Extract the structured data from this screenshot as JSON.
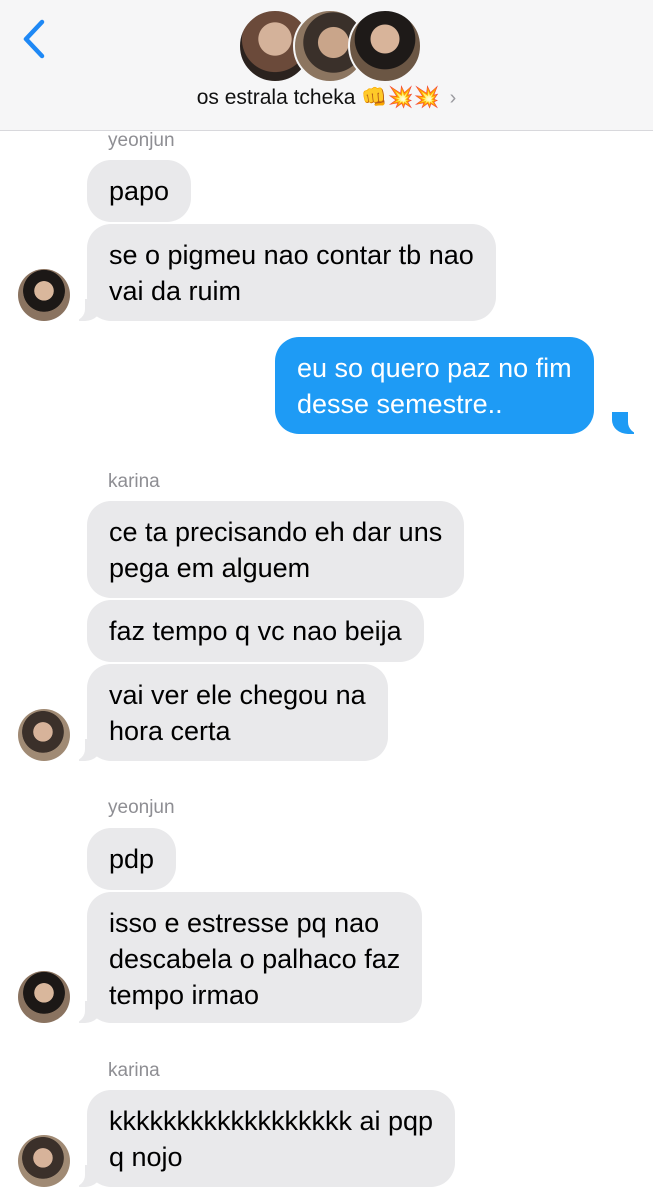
{
  "header": {
    "group_name": "os estrala tcheka 👊💥💥",
    "chevron": "›",
    "back_icon": "chevron-left-icon",
    "accent_color": "#1e88f5"
  },
  "messages": [
    {
      "sender_label": "yeonjun"
    },
    {
      "text": "papo"
    },
    {
      "text_lines": [
        "se o pigmeu nao contar tb nao",
        "vai da ruim"
      ]
    },
    {
      "text_lines": [
        "eu so quero paz no fim",
        "desse semestre.."
      ]
    },
    {
      "sender_label": "karina"
    },
    {
      "text_lines": [
        "ce ta precisando eh dar uns",
        "pega em alguem"
      ]
    },
    {
      "text": "faz tempo q vc nao beija"
    },
    {
      "text_lines": [
        "vai ver ele chegou na",
        "hora certa"
      ]
    },
    {
      "sender_label": "yeonjun"
    },
    {
      "text": "pdp"
    },
    {
      "text_lines": [
        "isso e estresse pq nao",
        "descabela o palhaco faz",
        "tempo irmao"
      ]
    },
    {
      "sender_label": "karina"
    },
    {
      "text_lines": [
        "kkkkkkkkkkkkkkkkkk ai pqp",
        "q nojo"
      ]
    }
  ],
  "colors": {
    "incoming_bubble": "#e9e9eb",
    "outgoing_bubble": "#1e9bf5",
    "sender_label": "#8e8e93"
  }
}
